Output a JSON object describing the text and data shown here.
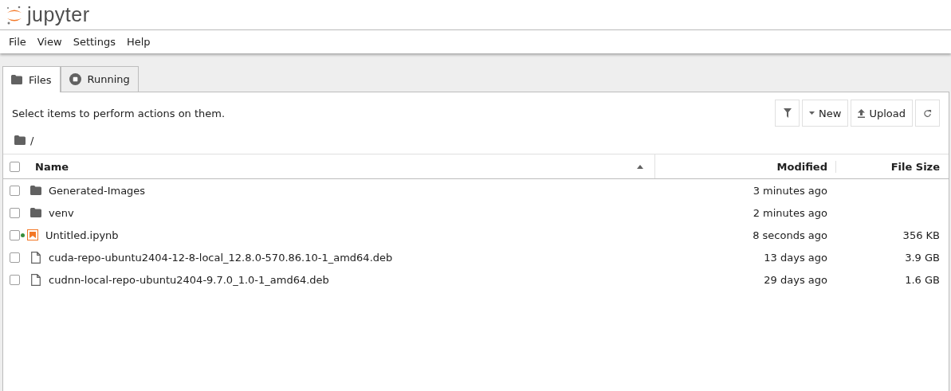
{
  "logo": {
    "text": "jupyter"
  },
  "menu": [
    "File",
    "View",
    "Settings",
    "Help"
  ],
  "tabs": [
    {
      "label": "Files",
      "kind": "folder",
      "selected": true
    },
    {
      "label": "Running",
      "kind": "stop",
      "selected": false
    }
  ],
  "hint": "Select items to perform actions on them.",
  "toolbar": [
    {
      "kind": "filter"
    },
    {
      "kind": "new",
      "label": "New"
    },
    {
      "kind": "upload",
      "label": "Upload"
    },
    {
      "kind": "refresh"
    }
  ],
  "breadcrumb": "/",
  "table": {
    "columns": [
      "Name",
      "Modified",
      "File Size"
    ],
    "select_all_checked": false,
    "rows": [
      {
        "kind": "folder",
        "name": "Generated-Images",
        "modified": "3 minutes ago",
        "checked": false,
        "running": false
      },
      {
        "kind": "folder",
        "name": "venv",
        "modified": "2 minutes ago",
        "checked": false,
        "running": false
      },
      {
        "kind": "notebook",
        "name": "Untitled.ipynb",
        "modified": "8 seconds ago",
        "size": "356 KB",
        "checked": false,
        "running": true
      },
      {
        "kind": "file",
        "name": "cuda-repo-ubuntu2404-12-8-local_12.8.0-570.86.10-1_amd64.deb",
        "modified": "13 days ago",
        "size": "3.9 GB",
        "checked": false,
        "running": false
      },
      {
        "kind": "file",
        "name": "cudnn-local-repo-ubuntu2404-9.7.0_1.0-1_amd64.deb",
        "modified": "29 days ago",
        "size": "1.6 GB",
        "checked": false,
        "running": false
      }
    ]
  }
}
